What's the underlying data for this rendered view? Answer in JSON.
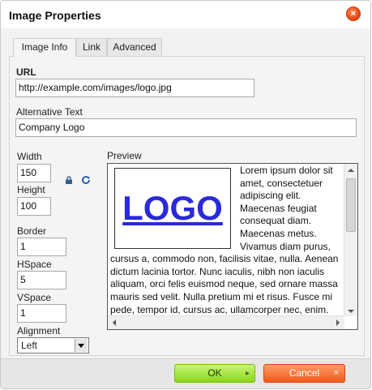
{
  "dialog": {
    "title": "Image Properties",
    "close_glyph": "×"
  },
  "tabs": [
    {
      "label": "Image Info",
      "active": true
    },
    {
      "label": "Link",
      "active": false
    },
    {
      "label": "Advanced",
      "active": false
    }
  ],
  "image_info": {
    "url_label": "URL",
    "url_value": "http://example.com/images/logo.jpg",
    "alt_label": "Alternative Text",
    "alt_value": "Company Logo",
    "width_label": "Width",
    "width_value": "150",
    "height_label": "Height",
    "height_value": "100",
    "border_label": "Border",
    "border_value": "1",
    "hspace_label": "HSpace",
    "hspace_value": "5",
    "vspace_label": "VSpace",
    "vspace_value": "1",
    "alignment_label": "Alignment",
    "alignment_value": "Left",
    "lock_icon": "lock-icon",
    "reset_icon": "reset-size-icon"
  },
  "preview": {
    "label": "Preview",
    "logo_text": "LOGO",
    "logo_color": "#2a2ad8",
    "text": "Lorem ipsum dolor sit amet, consectetuer adipiscing elit. Maecenas feugiat consequat diam. Maecenas metus. Vivamus diam purus, cursus a, commodo non, facilisis vitae, nulla. Aenean dictum lacinia tortor. Nunc iaculis, nibh non iaculis aliquam, orci felis euismod neque, sed ornare massa mauris sed velit. Nulla pretium mi et risus. Fusce mi pede, tempor id, cursus ac, ullamcorper nec, enim. Sed tortor. Curabitur"
  },
  "footer": {
    "ok_label": "OK",
    "ok_tail": "▸",
    "cancel_label": "Cancel",
    "cancel_tail": "✕",
    "ok_color": "#8dd616",
    "cancel_color": "#f25a1a"
  }
}
